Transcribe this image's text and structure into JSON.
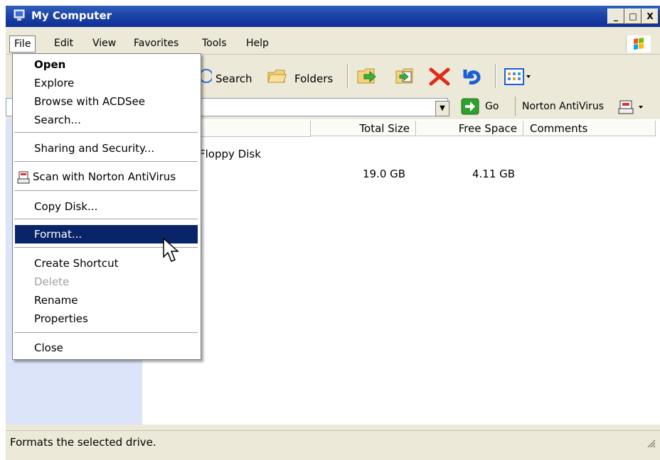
{
  "window": {
    "title": "My Computer",
    "min_label": "_",
    "max_label": "□",
    "close_label": "X"
  },
  "menubar": {
    "items": [
      "File",
      "Edit",
      "View",
      "Favorites",
      "Tools",
      "Help"
    ]
  },
  "toolbar": {
    "search_label": "Search",
    "folders_label": "Folders"
  },
  "addressbar": {
    "go_label": "Go",
    "norton_label": "Norton AntiVirus"
  },
  "columns": {
    "total_size": "Total Size",
    "free_space": "Free Space",
    "comments": "Comments"
  },
  "rows": [
    {
      "name": "Floppy Disk",
      "total": "",
      "free": ""
    },
    {
      "name": "",
      "total": "19.0 GB",
      "free": "4.11 GB"
    }
  ],
  "file_menu": {
    "open": "Open",
    "explore": "Explore",
    "browse": "Browse with ACDSee",
    "search": "Search...",
    "sharing": "Sharing and Security...",
    "norton_scan": "Scan with Norton AntiVirus",
    "copy_disk": "Copy Disk...",
    "format": "Format...",
    "create_shortcut": "Create Shortcut",
    "delete": "Delete",
    "rename": "Rename",
    "properties": "Properties",
    "close": "Close"
  },
  "status": {
    "text": "Formats the selected drive."
  },
  "colors": {
    "menu_selected": "#0a246a",
    "titlebar": "#0f2f96",
    "chrome": "#ece9d8"
  }
}
